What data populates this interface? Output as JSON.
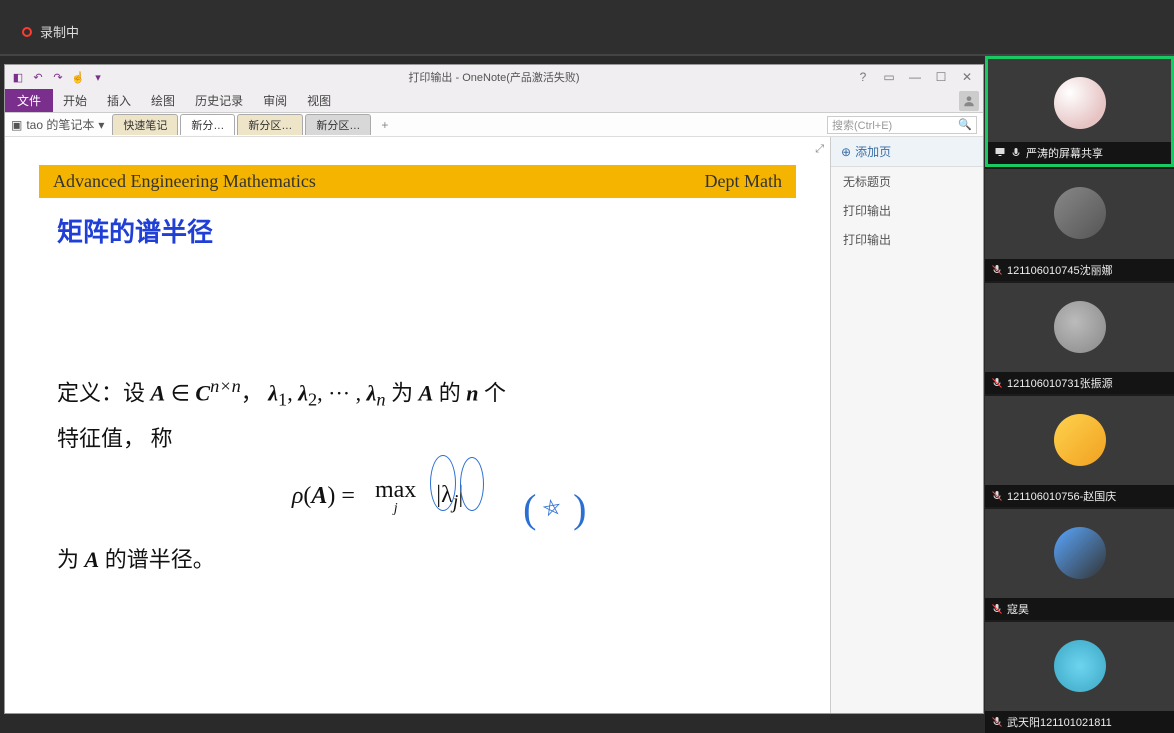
{
  "recording_label": "录制中",
  "onenote": {
    "window_title": "打印输出 - OneNote(产品激活失败)",
    "file_tab": "文件",
    "tabs": [
      "开始",
      "插入",
      "绘图",
      "历史记录",
      "审阅",
      "视图"
    ],
    "notebook_name": "tao 的笔记本",
    "sections": [
      {
        "label": "快速笔记",
        "cls": "sec-tab"
      },
      {
        "label": "新分…",
        "cls": "sec-tab grey active"
      },
      {
        "label": "新分区…",
        "cls": "sec-tab"
      },
      {
        "label": "新分区…",
        "cls": "sec-tab grey"
      }
    ],
    "add_section": "+",
    "search_placeholder": "搜索(Ctrl+E)",
    "side": {
      "add_page": "添加页",
      "items": [
        "无标题页",
        "打印输出",
        "打印输出"
      ]
    }
  },
  "slide": {
    "header_left": "Advanced Engineering Mathematics",
    "header_right": "Dept Math",
    "title": "矩阵的谱半径",
    "line1_prefix": "定义：设 ",
    "line1_mid": "， ",
    "line1_tail1": " 为 ",
    "line1_tail2": " 的 ",
    "line1_tail3": " 个",
    "line2": "特征值， 称",
    "rho": "ρ",
    "eq": " = ",
    "max": "max",
    "sub_j": "j",
    "abs_lj": "|λ",
    "abs_close": "|",
    "line3_prefix": "为 ",
    "line3_suffix": " 的谱半径。"
  },
  "participants": [
    {
      "name": "严涛的屏幕共享",
      "muted": false,
      "presenter": true,
      "badge": true,
      "avatar": "c1"
    },
    {
      "name": "121106010745沈丽娜",
      "muted": true,
      "avatar": "c2"
    },
    {
      "name": "121106010731张振源",
      "muted": true,
      "avatar": "c3"
    },
    {
      "name": "121106010756-赵国庆",
      "muted": true,
      "avatar": "c4"
    },
    {
      "name": "寇昊",
      "muted": true,
      "avatar": "c5"
    },
    {
      "name": "武天阳121101021811",
      "muted": true,
      "avatar": "c6"
    }
  ]
}
